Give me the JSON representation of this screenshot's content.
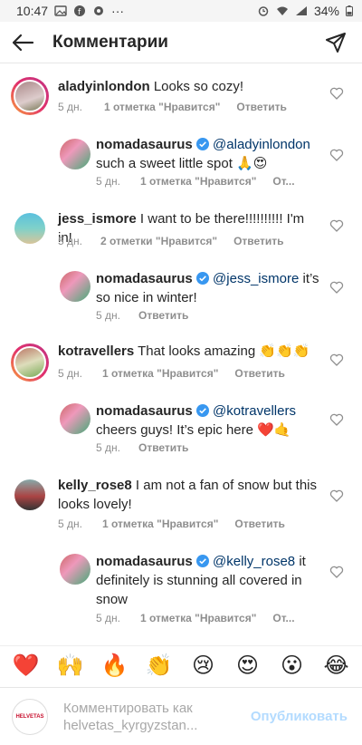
{
  "status": {
    "time": "10:47",
    "battery": "34%",
    "more": "···"
  },
  "header": {
    "title": "Комментарии"
  },
  "reply_label": "Ответить",
  "reply_label_short": "От...",
  "comments": [
    {
      "user": "aladyinlondon",
      "text": " Looks so cozy!",
      "age": "5 дн.",
      "likes": "1 отметка \"Нравится\""
    },
    {
      "user": "nomadasaurus",
      "mention": "@aladyinlondon",
      "text": "such a sweet little spot 🙏😍",
      "age": "5 дн.",
      "likes": "1 отметка \"Нравится\""
    },
    {
      "user": "jess_ismore",
      "text": " I want to be there!!!!!!!!!! I'm in!",
      "age": "5 дн.",
      "likes": "2 отметки \"Нравится\""
    },
    {
      "user": "nomadasaurus",
      "mention": "@jess_ismore",
      "text_a": " it’s",
      "text": "so nice in winter!",
      "age": "5 дн."
    },
    {
      "user": "kotravellers",
      "text": " That looks amazing 👏👏👏",
      "age": "5 дн.",
      "likes": "1 отметка \"Нравится\""
    },
    {
      "user": "nomadasaurus",
      "mention": "@kotravellers",
      "text": "cheers guys! It’s epic here ❤️🤙",
      "age": "5 дн."
    },
    {
      "user": "kelly_rose8",
      "text_a": " I am not a fan of snow but this",
      "text": "looks lovely!",
      "age": "5 дн.",
      "likes": "1 отметка \"Нравится\""
    },
    {
      "user": "nomadasaurus",
      "mention": "@kelly_rose8",
      "text_a": " it",
      "text": "definitely is stunning all covered in",
      "text_c": "snow",
      "age": "5 дн.",
      "likes": "1 отметка \"Нравится\""
    }
  ],
  "emoji_bar": [
    "❤️",
    "🙌",
    "🔥",
    "👏",
    "😢",
    "😍",
    "😮",
    "😂"
  ],
  "composer": {
    "avatar_text": "HELVETAS",
    "placeholder_line1": "Комментировать как",
    "placeholder_line2": "helvetas_kyrgyzstan...",
    "post_label": "Опубликовать"
  },
  "colors": {
    "accent": "#0095f6",
    "mention": "#003569",
    "meta": "#8e8e8e",
    "post_disabled": "#b3dbff"
  }
}
